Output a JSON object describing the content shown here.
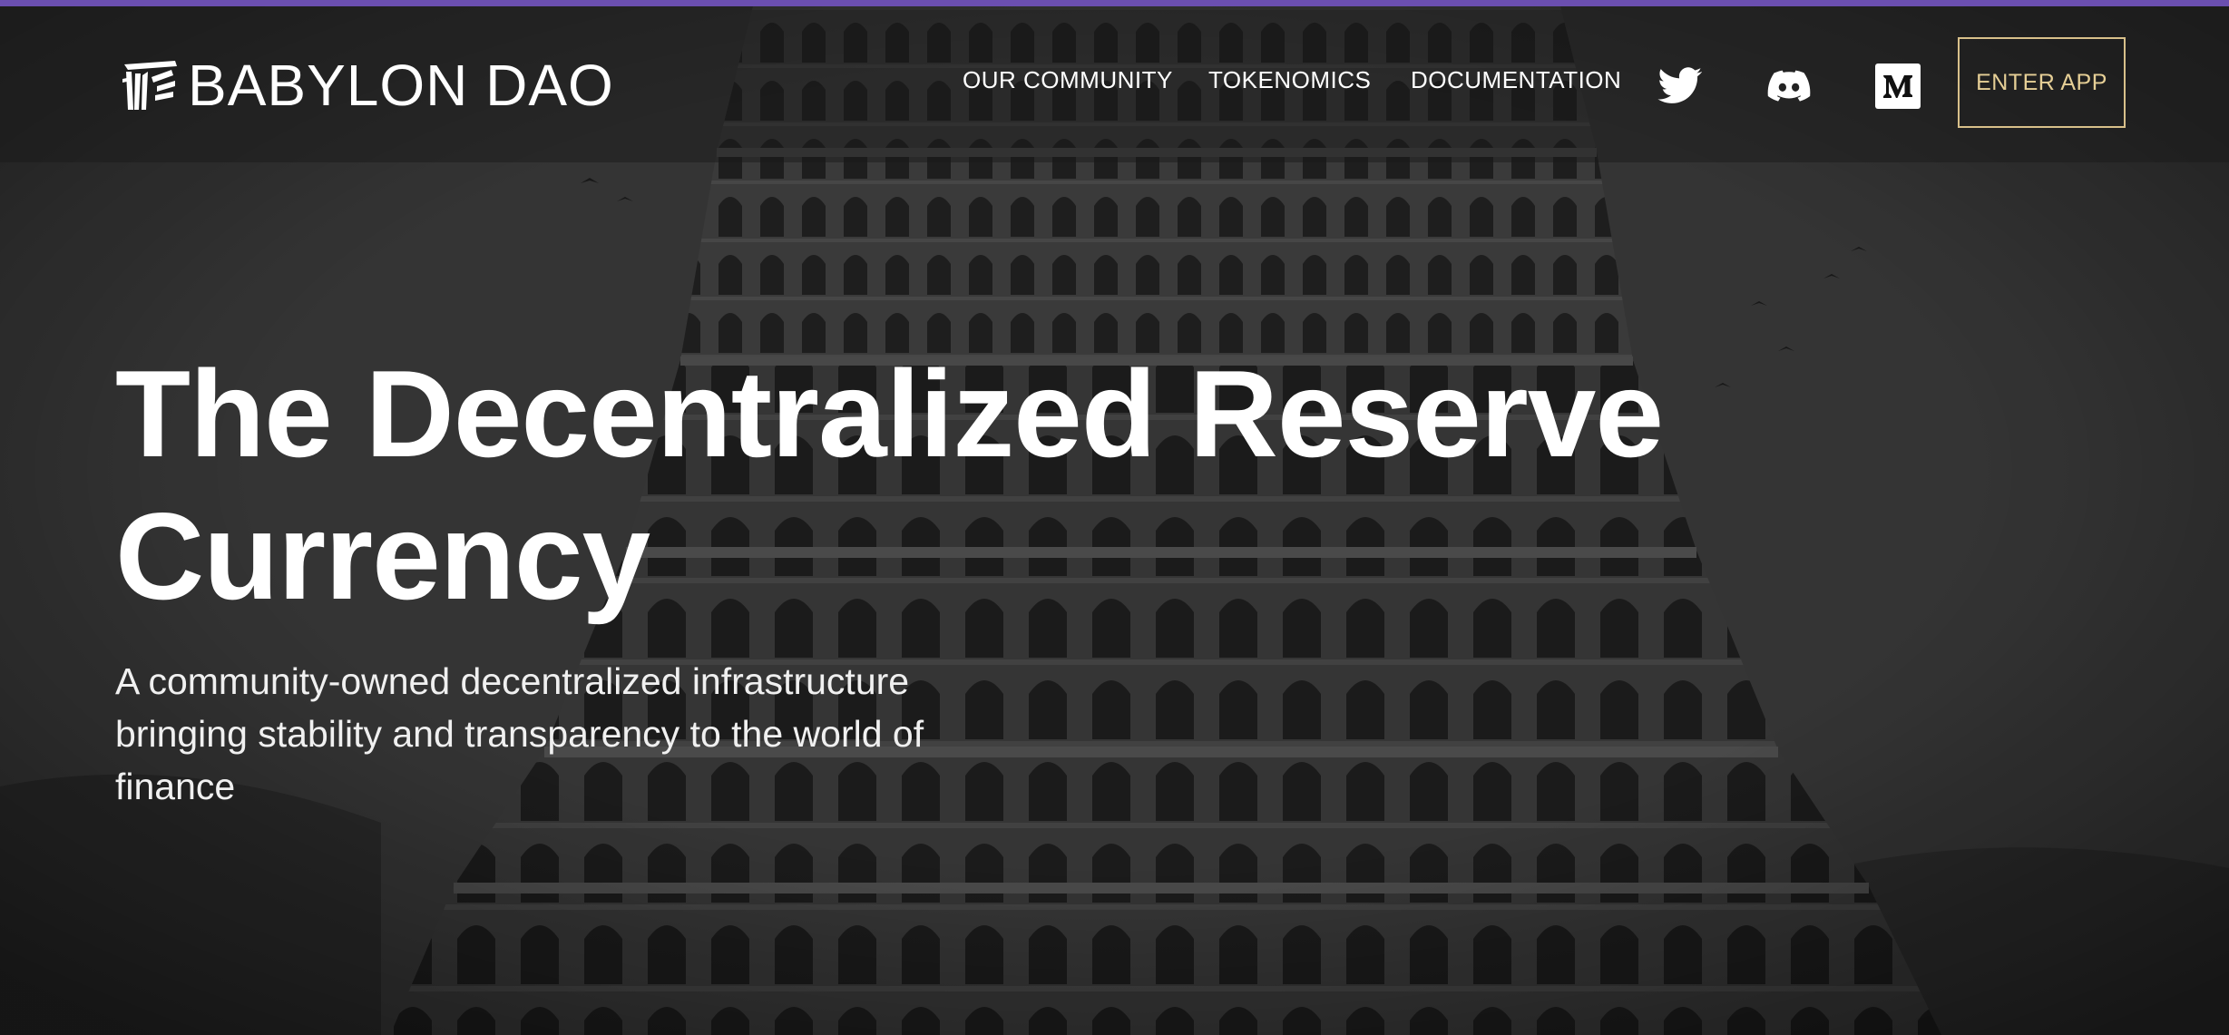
{
  "brand": {
    "name": "BABYLON DAO",
    "logo_icon": "babylon-tower-logo-icon"
  },
  "nav": {
    "items": [
      {
        "label": "OUR COMMUNITY"
      },
      {
        "label": "TOKENOMICS"
      },
      {
        "label": "DOCUMENTATION"
      }
    ],
    "social": [
      {
        "icon": "twitter-icon"
      },
      {
        "icon": "discord-icon"
      },
      {
        "icon": "medium-icon"
      }
    ],
    "cta_label": "ENTER APP"
  },
  "hero": {
    "title_line1": "The Decentralized Reserve",
    "title_line2": "Currency",
    "subtitle": "A community-owned decentralized infrastructure bringing stability and transparency to the world of finance"
  },
  "colors": {
    "accent_bar": "#6b4fb0",
    "cta_border": "#d8c08a",
    "text": "#ffffff",
    "background": "#3a3a3a"
  }
}
